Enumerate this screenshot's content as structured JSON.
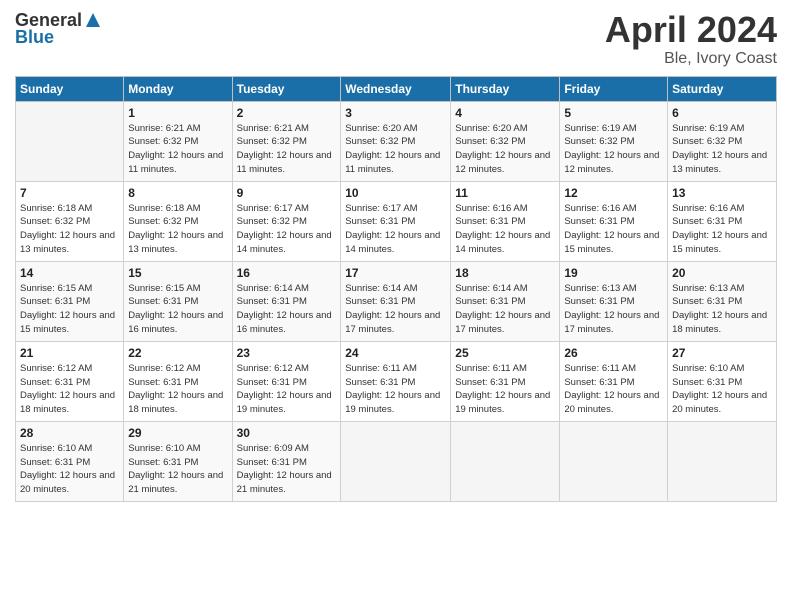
{
  "header": {
    "logo_general": "General",
    "logo_blue": "Blue",
    "title": "April 2024",
    "location": "Ble, Ivory Coast"
  },
  "days_of_week": [
    "Sunday",
    "Monday",
    "Tuesday",
    "Wednesday",
    "Thursday",
    "Friday",
    "Saturday"
  ],
  "weeks": [
    [
      {
        "day": "",
        "sunrise": "",
        "sunset": "",
        "daylight": ""
      },
      {
        "day": "1",
        "sunrise": "Sunrise: 6:21 AM",
        "sunset": "Sunset: 6:32 PM",
        "daylight": "Daylight: 12 hours and 11 minutes."
      },
      {
        "day": "2",
        "sunrise": "Sunrise: 6:21 AM",
        "sunset": "Sunset: 6:32 PM",
        "daylight": "Daylight: 12 hours and 11 minutes."
      },
      {
        "day": "3",
        "sunrise": "Sunrise: 6:20 AM",
        "sunset": "Sunset: 6:32 PM",
        "daylight": "Daylight: 12 hours and 11 minutes."
      },
      {
        "day": "4",
        "sunrise": "Sunrise: 6:20 AM",
        "sunset": "Sunset: 6:32 PM",
        "daylight": "Daylight: 12 hours and 12 minutes."
      },
      {
        "day": "5",
        "sunrise": "Sunrise: 6:19 AM",
        "sunset": "Sunset: 6:32 PM",
        "daylight": "Daylight: 12 hours and 12 minutes."
      },
      {
        "day": "6",
        "sunrise": "Sunrise: 6:19 AM",
        "sunset": "Sunset: 6:32 PM",
        "daylight": "Daylight: 12 hours and 13 minutes."
      }
    ],
    [
      {
        "day": "7",
        "sunrise": "Sunrise: 6:18 AM",
        "sunset": "Sunset: 6:32 PM",
        "daylight": "Daylight: 12 hours and 13 minutes."
      },
      {
        "day": "8",
        "sunrise": "Sunrise: 6:18 AM",
        "sunset": "Sunset: 6:32 PM",
        "daylight": "Daylight: 12 hours and 13 minutes."
      },
      {
        "day": "9",
        "sunrise": "Sunrise: 6:17 AM",
        "sunset": "Sunset: 6:32 PM",
        "daylight": "Daylight: 12 hours and 14 minutes."
      },
      {
        "day": "10",
        "sunrise": "Sunrise: 6:17 AM",
        "sunset": "Sunset: 6:31 PM",
        "daylight": "Daylight: 12 hours and 14 minutes."
      },
      {
        "day": "11",
        "sunrise": "Sunrise: 6:16 AM",
        "sunset": "Sunset: 6:31 PM",
        "daylight": "Daylight: 12 hours and 14 minutes."
      },
      {
        "day": "12",
        "sunrise": "Sunrise: 6:16 AM",
        "sunset": "Sunset: 6:31 PM",
        "daylight": "Daylight: 12 hours and 15 minutes."
      },
      {
        "day": "13",
        "sunrise": "Sunrise: 6:16 AM",
        "sunset": "Sunset: 6:31 PM",
        "daylight": "Daylight: 12 hours and 15 minutes."
      }
    ],
    [
      {
        "day": "14",
        "sunrise": "Sunrise: 6:15 AM",
        "sunset": "Sunset: 6:31 PM",
        "daylight": "Daylight: 12 hours and 15 minutes."
      },
      {
        "day": "15",
        "sunrise": "Sunrise: 6:15 AM",
        "sunset": "Sunset: 6:31 PM",
        "daylight": "Daylight: 12 hours and 16 minutes."
      },
      {
        "day": "16",
        "sunrise": "Sunrise: 6:14 AM",
        "sunset": "Sunset: 6:31 PM",
        "daylight": "Daylight: 12 hours and 16 minutes."
      },
      {
        "day": "17",
        "sunrise": "Sunrise: 6:14 AM",
        "sunset": "Sunset: 6:31 PM",
        "daylight": "Daylight: 12 hours and 17 minutes."
      },
      {
        "day": "18",
        "sunrise": "Sunrise: 6:14 AM",
        "sunset": "Sunset: 6:31 PM",
        "daylight": "Daylight: 12 hours and 17 minutes."
      },
      {
        "day": "19",
        "sunrise": "Sunrise: 6:13 AM",
        "sunset": "Sunset: 6:31 PM",
        "daylight": "Daylight: 12 hours and 17 minutes."
      },
      {
        "day": "20",
        "sunrise": "Sunrise: 6:13 AM",
        "sunset": "Sunset: 6:31 PM",
        "daylight": "Daylight: 12 hours and 18 minutes."
      }
    ],
    [
      {
        "day": "21",
        "sunrise": "Sunrise: 6:12 AM",
        "sunset": "Sunset: 6:31 PM",
        "daylight": "Daylight: 12 hours and 18 minutes."
      },
      {
        "day": "22",
        "sunrise": "Sunrise: 6:12 AM",
        "sunset": "Sunset: 6:31 PM",
        "daylight": "Daylight: 12 hours and 18 minutes."
      },
      {
        "day": "23",
        "sunrise": "Sunrise: 6:12 AM",
        "sunset": "Sunset: 6:31 PM",
        "daylight": "Daylight: 12 hours and 19 minutes."
      },
      {
        "day": "24",
        "sunrise": "Sunrise: 6:11 AM",
        "sunset": "Sunset: 6:31 PM",
        "daylight": "Daylight: 12 hours and 19 minutes."
      },
      {
        "day": "25",
        "sunrise": "Sunrise: 6:11 AM",
        "sunset": "Sunset: 6:31 PM",
        "daylight": "Daylight: 12 hours and 19 minutes."
      },
      {
        "day": "26",
        "sunrise": "Sunrise: 6:11 AM",
        "sunset": "Sunset: 6:31 PM",
        "daylight": "Daylight: 12 hours and 20 minutes."
      },
      {
        "day": "27",
        "sunrise": "Sunrise: 6:10 AM",
        "sunset": "Sunset: 6:31 PM",
        "daylight": "Daylight: 12 hours and 20 minutes."
      }
    ],
    [
      {
        "day": "28",
        "sunrise": "Sunrise: 6:10 AM",
        "sunset": "Sunset: 6:31 PM",
        "daylight": "Daylight: 12 hours and 20 minutes."
      },
      {
        "day": "29",
        "sunrise": "Sunrise: 6:10 AM",
        "sunset": "Sunset: 6:31 PM",
        "daylight": "Daylight: 12 hours and 21 minutes."
      },
      {
        "day": "30",
        "sunrise": "Sunrise: 6:09 AM",
        "sunset": "Sunset: 6:31 PM",
        "daylight": "Daylight: 12 hours and 21 minutes."
      },
      {
        "day": "",
        "sunrise": "",
        "sunset": "",
        "daylight": ""
      },
      {
        "day": "",
        "sunrise": "",
        "sunset": "",
        "daylight": ""
      },
      {
        "day": "",
        "sunrise": "",
        "sunset": "",
        "daylight": ""
      },
      {
        "day": "",
        "sunrise": "",
        "sunset": "",
        "daylight": ""
      }
    ]
  ]
}
